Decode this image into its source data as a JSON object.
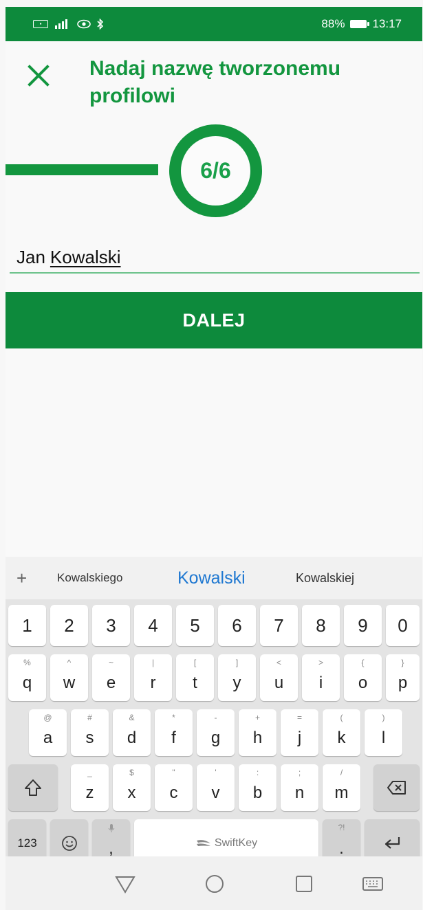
{
  "status_bar": {
    "left_icons": [
      "sim-icon",
      "signal-icon",
      "eye-icon",
      "bluetooth-icon"
    ],
    "battery_percent": "88%",
    "time": "13:17"
  },
  "header": {
    "title": "Nadaj nazwę tworzonemu profilowi",
    "close_icon": "close-icon"
  },
  "stepper": {
    "label": "6/6",
    "current_step": 6,
    "total_steps": 6
  },
  "form": {
    "name_first": "Jan",
    "name_last": "Kowalski"
  },
  "next_button": {
    "label": "DALEJ"
  },
  "keyboard": {
    "suggestions": [
      "Kowalskiego",
      "Kowalski",
      "Kowalskiej"
    ],
    "number_row": [
      "1",
      "2",
      "3",
      "4",
      "5",
      "6",
      "7",
      "8",
      "9",
      "0"
    ],
    "row1": [
      {
        "alt": "%",
        "main": "q"
      },
      {
        "alt": "^",
        "main": "w"
      },
      {
        "alt": "~",
        "main": "e"
      },
      {
        "alt": "|",
        "main": "r"
      },
      {
        "alt": "[",
        "main": "t"
      },
      {
        "alt": "]",
        "main": "y"
      },
      {
        "alt": "<",
        "main": "u"
      },
      {
        "alt": ">",
        "main": "i"
      },
      {
        "alt": "{",
        "main": "o"
      },
      {
        "alt": "}",
        "main": "p"
      }
    ],
    "row2": [
      {
        "alt": "@",
        "main": "a"
      },
      {
        "alt": "#",
        "main": "s"
      },
      {
        "alt": "&",
        "main": "d"
      },
      {
        "alt": "*",
        "main": "f"
      },
      {
        "alt": "-",
        "main": "g"
      },
      {
        "alt": "+",
        "main": "h"
      },
      {
        "alt": "=",
        "main": "j"
      },
      {
        "alt": "(",
        "main": "k"
      },
      {
        "alt": ")",
        "main": "l"
      }
    ],
    "row3": [
      {
        "alt": "_",
        "main": "z"
      },
      {
        "alt": "$",
        "main": "x"
      },
      {
        "alt": "\"",
        "main": "c"
      },
      {
        "alt": "'",
        "main": "v"
      },
      {
        "alt": ":",
        "main": "b"
      },
      {
        "alt": ";",
        "main": "n"
      },
      {
        "alt": "/",
        "main": "m"
      }
    ],
    "symbols_label": "123",
    "space_label": "SwiftKey",
    "comma": ",",
    "period": ".",
    "period_alt": "?!"
  },
  "colors": {
    "brand_green": "#0d8a3c",
    "title_green": "#13963f",
    "suggestion_blue": "#1f78d1"
  }
}
